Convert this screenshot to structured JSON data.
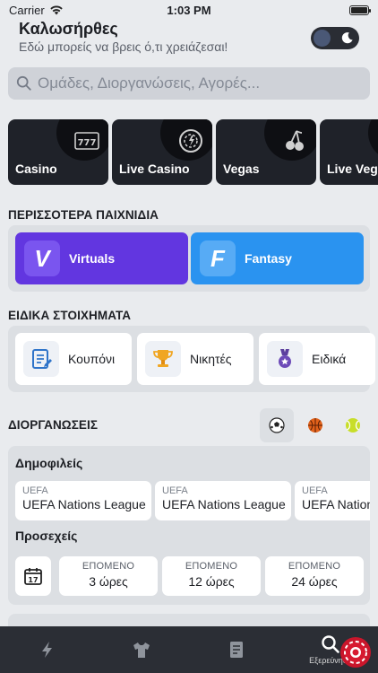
{
  "status_bar": {
    "carrier": "Carrier",
    "time": "1:03 PM"
  },
  "header": {
    "greeting": "Καλωσήρθες",
    "subtitle": "Εδώ μπορείς να βρεις ό,τι χρειάζεσαι!"
  },
  "search": {
    "placeholder": "Ομάδες, Διοργανώσεις, Αγορές..."
  },
  "casino": [
    {
      "label": "Casino",
      "icon": "slot-777-icon"
    },
    {
      "label": "Live Casino",
      "icon": "roulette-icon"
    },
    {
      "label": "Vegas",
      "icon": "cherries-icon"
    },
    {
      "label": "Live Vega",
      "icon": "live-vegas-icon"
    }
  ],
  "more_games": {
    "title": "ΠΕΡΙΣΣΟΤΕΡΑ ΠΑΙΧΝΙΔΙΑ",
    "items": [
      {
        "label": "Virtuals",
        "letter": "V",
        "color": "#6236e0"
      },
      {
        "label": "Fantasy",
        "letter": "F",
        "color": "#2a93f0"
      }
    ]
  },
  "special_bets": {
    "title": "ΕΙΔΙΚΑ ΣΤΟΙΧΗΜΑΤΑ",
    "items": [
      {
        "label": "Κουπόνι",
        "icon": "coupon-icon"
      },
      {
        "label": "Νικητές",
        "icon": "trophy-icon"
      },
      {
        "label": "Ειδικά",
        "icon": "medal-icon"
      }
    ]
  },
  "competitions": {
    "title": "ΔΙΟΡΓΑΝΩΣΕΙΣ",
    "sports": [
      "soccer-icon",
      "basketball-icon",
      "tennis-icon"
    ],
    "popular_title": "Δημοφιλείς",
    "popular": [
      {
        "sport": "UEFA",
        "name": "UEFA Nations League"
      },
      {
        "sport": "UEFA",
        "name": "UEFA Nations League"
      },
      {
        "sport": "UEFA",
        "name": "UEFA Nations League"
      }
    ],
    "upcoming_title": "Προσεχείς",
    "calendar_day": "17",
    "upcoming": [
      {
        "label": "ΕΠΟΜΕΝΟ",
        "value": "3 ώρες"
      },
      {
        "label": "ΕΠΟΜΕΝΟ",
        "value": "12 ώρες"
      },
      {
        "label": "ΕΠΟΜΕΝΟ",
        "value": "24 ώρες"
      }
    ]
  },
  "tab_bar": {
    "tabs": [
      {
        "icon": "lightning-icon"
      },
      {
        "icon": "jersey-icon"
      },
      {
        "icon": "betslip-icon"
      },
      {
        "icon": "search-icon",
        "label": "Εξερεύνηση",
        "active": true
      }
    ]
  }
}
